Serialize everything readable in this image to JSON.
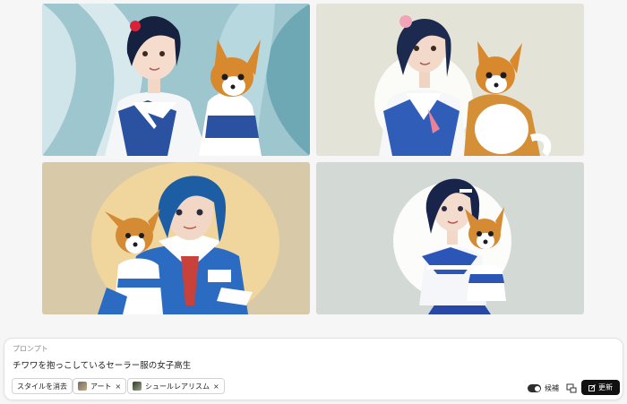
{
  "images": [
    {
      "alt": "セーラー服の女子高生とチワワ 1"
    },
    {
      "alt": "セーラー服の女子高生とチワワ 2"
    },
    {
      "alt": "セーラー服の女子高生とチワワ 3"
    },
    {
      "alt": "セーラー服の女子高生とチワワ 4"
    }
  ],
  "panel": {
    "label": "プロンプト",
    "prompt": "チワワを抱っこしているセーラー服の女子高生",
    "clear_style_label": "スタイルを消去",
    "styles": [
      {
        "label": "アート",
        "icon": "art-thumbnail",
        "remove": "×"
      },
      {
        "label": "シュールレアリスム",
        "icon": "surrealism-thumbnail",
        "remove": "×"
      }
    ],
    "candidates_label": "候補",
    "candidates_on": true,
    "update_label": "更新",
    "colors": {
      "update_bg": "#111111",
      "toggle_on": "#2d2d2d"
    }
  }
}
